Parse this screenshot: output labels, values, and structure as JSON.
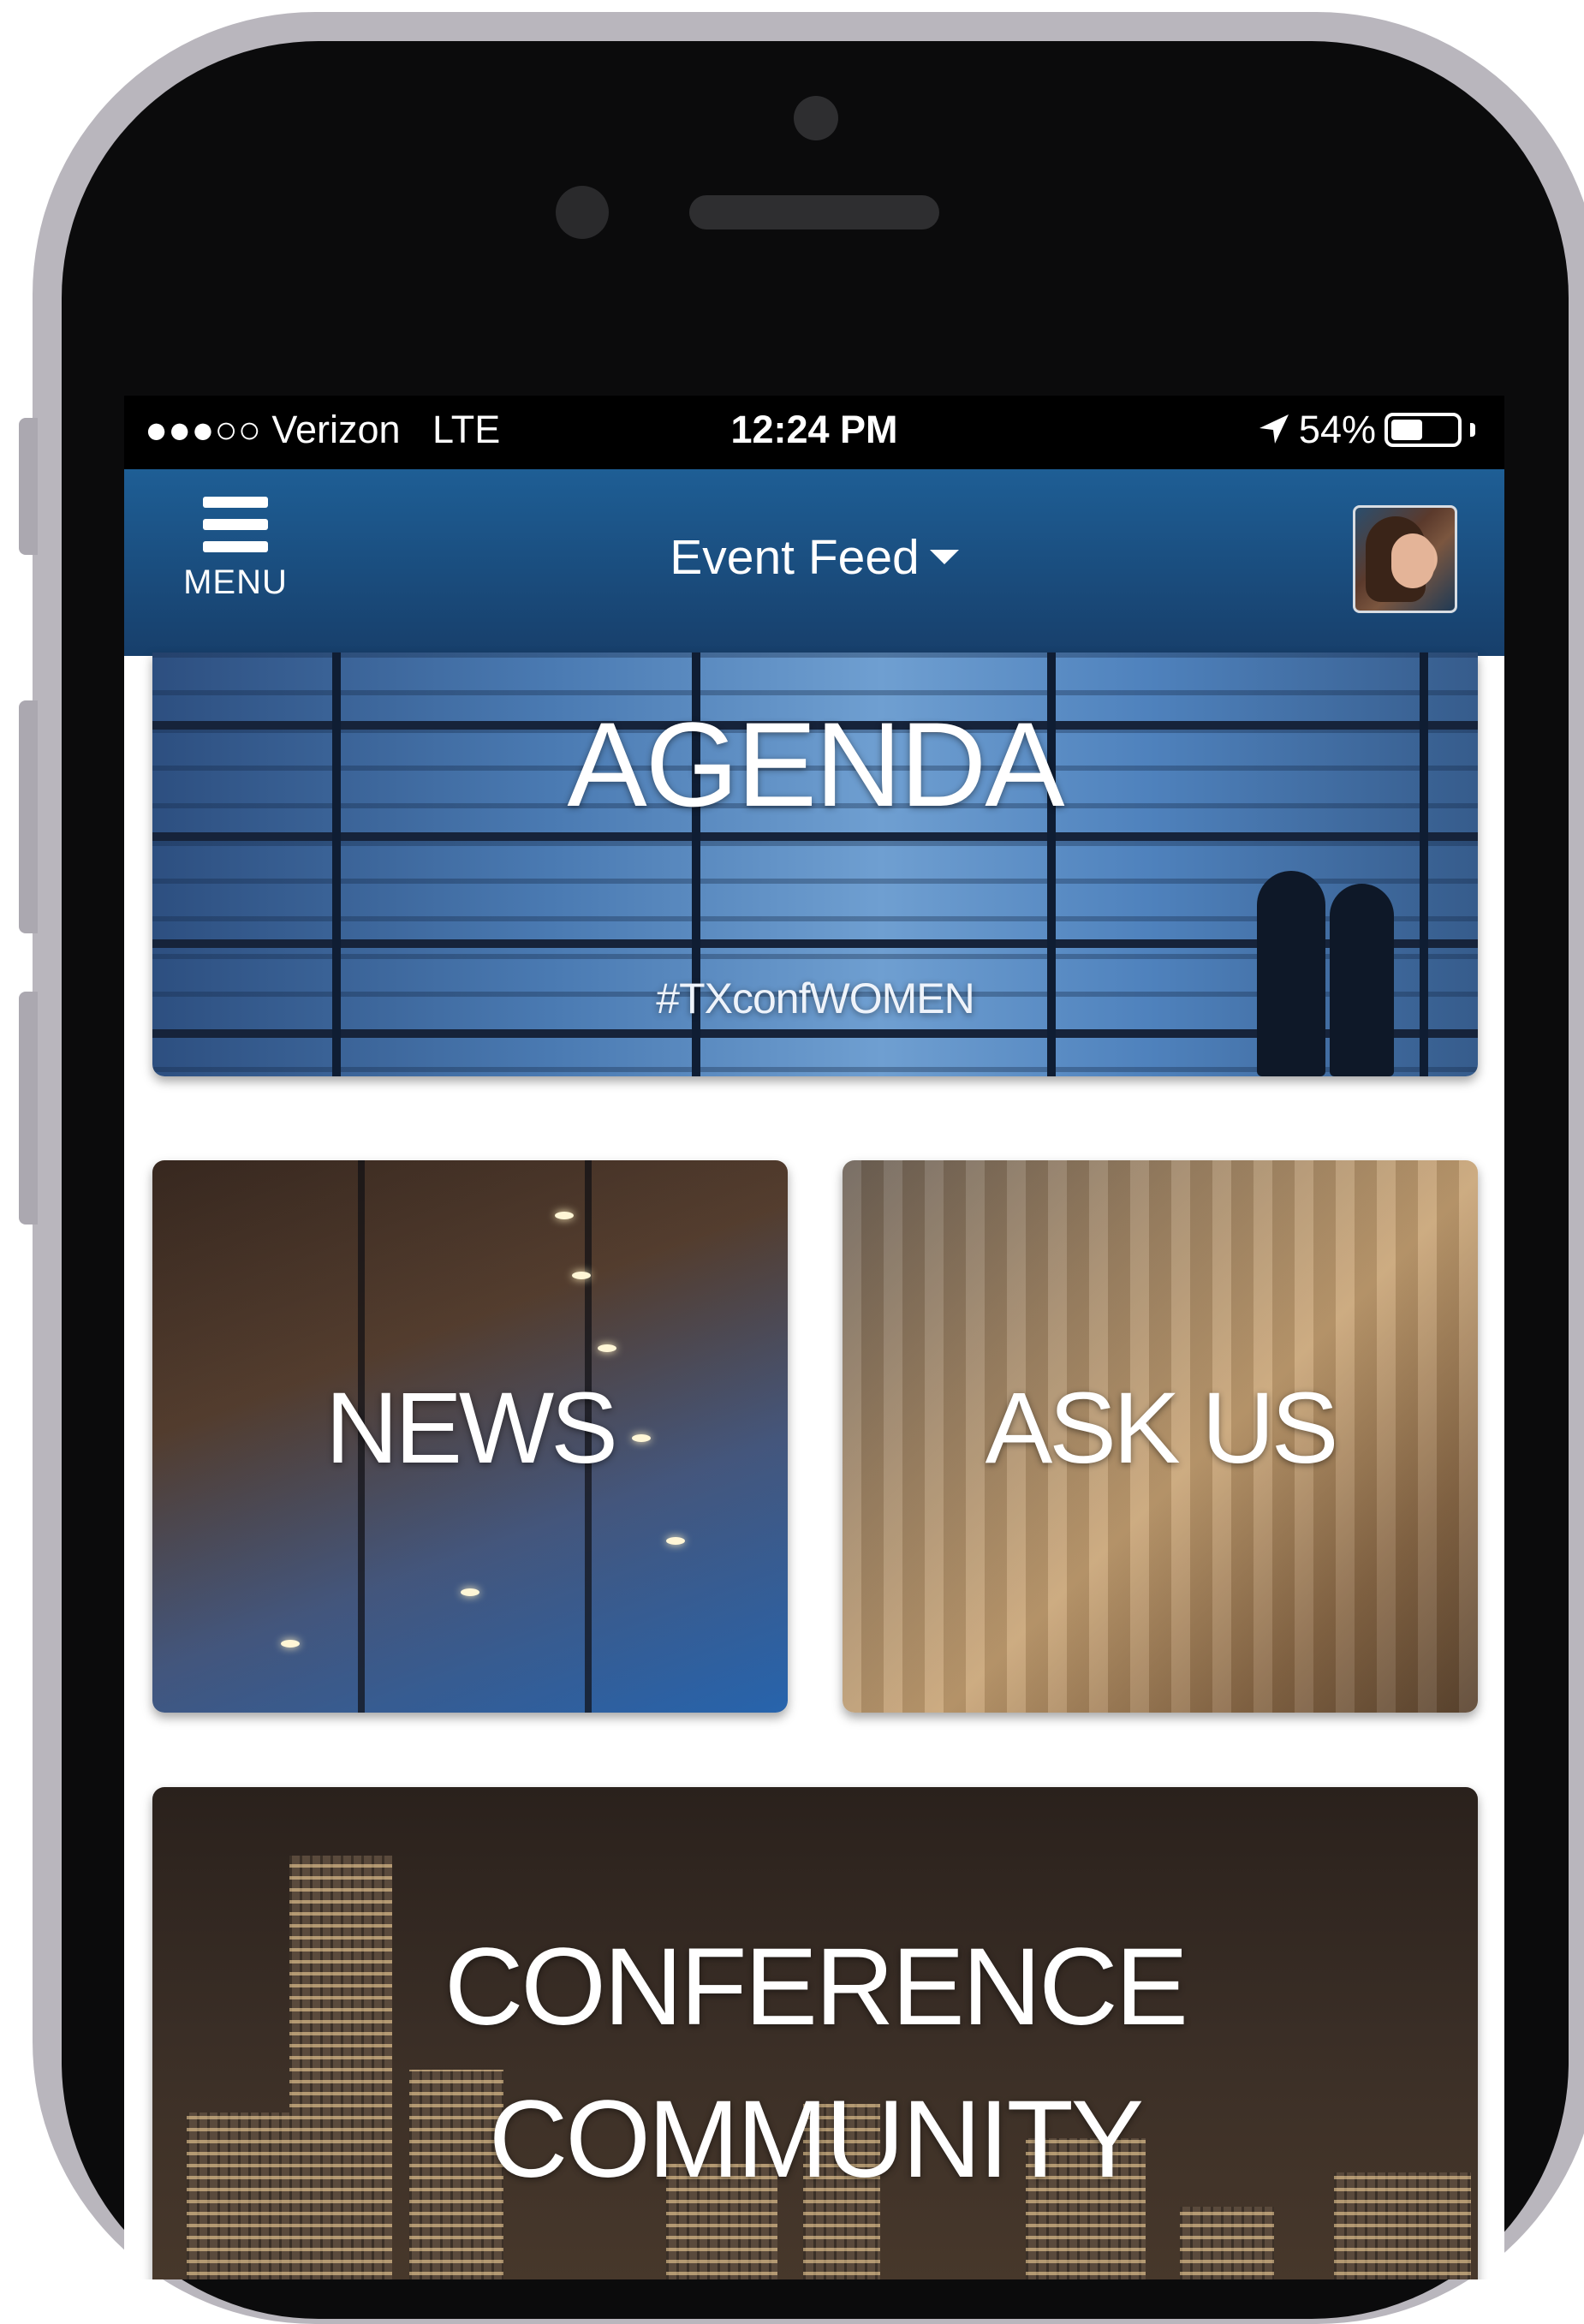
{
  "status_bar": {
    "signal": "●●●○○",
    "carrier": "Verizon",
    "network": "LTE",
    "time": "12:24 PM",
    "location_icon": "location-arrow-icon",
    "battery_percent": "54%",
    "battery_level": 0.54
  },
  "nav": {
    "menu_label": "MENU",
    "menu_icon": "hamburger-icon",
    "title": "Event Feed",
    "dropdown_icon": "caret-down-icon",
    "avatar_icon": "user-avatar"
  },
  "tiles": {
    "agenda": {
      "title": "AGENDA",
      "hashtag": "#TXconfWOMEN"
    },
    "news": {
      "title": "NEWS"
    },
    "ask_us": {
      "title": "ASK US"
    },
    "community": {
      "line1": "CONFERENCE",
      "line2": "COMMUNITY"
    }
  },
  "colors": {
    "nav_bar": "#1e5e95",
    "status_bar": "#000000",
    "phone_frame": "#b9b6bd"
  }
}
